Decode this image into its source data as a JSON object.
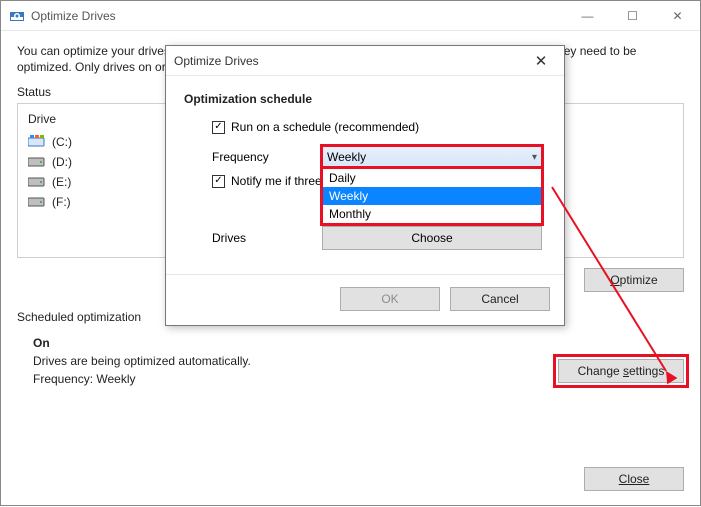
{
  "window": {
    "title": "Optimize Drives",
    "intro": "You can optimize your drives to help your computer run more efficiently, or analyze them to find out if they need to be optimized. Only drives on or connected to your computer are shown."
  },
  "status": {
    "label": "Status",
    "column_header": "Drive",
    "drives": [
      {
        "label": "(C:)",
        "type": "os"
      },
      {
        "label": "(D:)",
        "type": "hdd"
      },
      {
        "label": "(E:)",
        "type": "hdd"
      },
      {
        "label": "(F:)",
        "type": "hdd"
      }
    ]
  },
  "buttons": {
    "optimize": "Optimize",
    "change_settings": "Change settings",
    "close": "Close"
  },
  "scheduled": {
    "section": "Scheduled optimization",
    "state": "On",
    "line1": "Drives are being optimized automatically.",
    "line2": "Frequency: Weekly"
  },
  "dialog": {
    "title": "Optimize Drives",
    "heading": "Optimization schedule",
    "run_label": "Run on a schedule (recommended)",
    "frequency_label": "Frequency",
    "frequency_value": "Weekly",
    "options": {
      "daily": "Daily",
      "weekly": "Weekly",
      "monthly": "Monthly"
    },
    "notify_label": "Notify me if three consecutive scheduled runs are missed",
    "notify_label_truncated": "Notify me if three con",
    "drives_label": "Drives",
    "choose": "Choose",
    "ok": "OK",
    "cancel": "Cancel"
  },
  "titlebar_icons": {
    "min": "—",
    "max": "☐",
    "close": "✕"
  },
  "checkbox_mark": "✓"
}
